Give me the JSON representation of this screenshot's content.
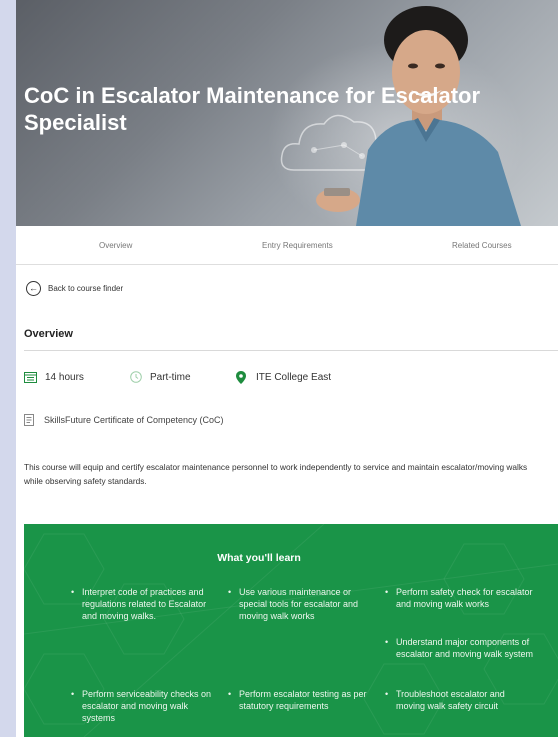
{
  "hero": {
    "title": "CoC in Escalator Maintenance for Escalator Specialist"
  },
  "tabs": [
    "Overview",
    "Entry Requirements",
    "Related Courses"
  ],
  "back_link": "Back to course finder",
  "overview": {
    "title": "Overview",
    "duration": "14 hours",
    "mode": "Part-time",
    "location": "ITE College East",
    "certificate": "SkillsFuture Certificate of Competency (CoC)",
    "description": "This course will equip and certify escalator maintenance personnel to work independently to service and maintain escalator/moving walks while observing safety standards."
  },
  "learn": {
    "title": "What you'll learn",
    "bullet": "•",
    "items": [
      "Interpret code of practices and regulations related to Escalator and moving walks.",
      "Use various maintenance or special tools for escalator and moving walk works",
      "Perform safety check for escalator and moving walk works",
      "Understand major components of escalator and moving walk system",
      "Perform serviceability checks on escalator and moving walk systems",
      "Perform escalator testing as per statutory requirements",
      "Troubleshoot escalator and moving walk safety circuit"
    ]
  },
  "colors": {
    "green": "#1a9448",
    "location_pin": "#1e8c3e",
    "hero_title": "#ffffff"
  },
  "icons": [
    "calendar-icon",
    "clock-icon",
    "location-pin-icon",
    "certificate-icon",
    "back-arrow-icon"
  ]
}
